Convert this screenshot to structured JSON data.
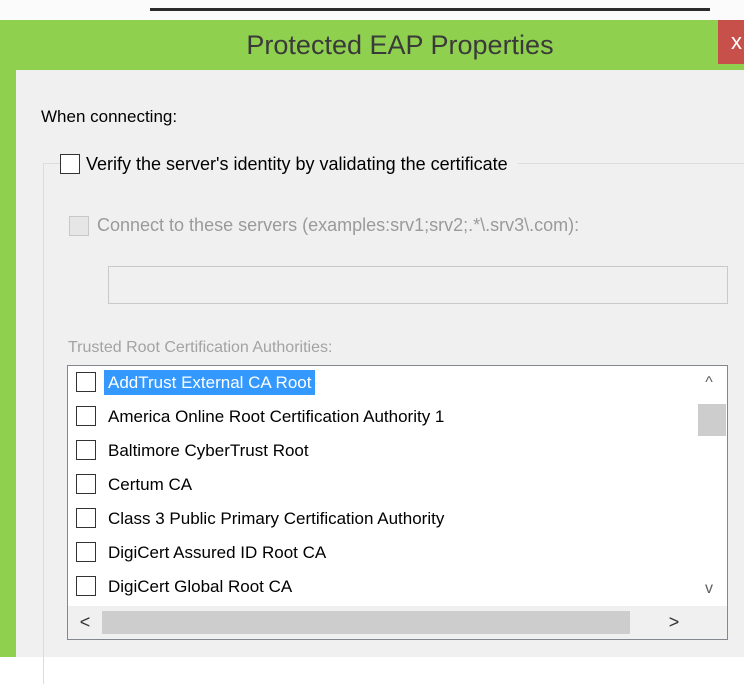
{
  "window": {
    "title": "Protected EAP Properties",
    "close_glyph": "x"
  },
  "section_label": "When connecting:",
  "verify": {
    "label": "Verify the server's identity by validating the certificate",
    "checked": false
  },
  "connect": {
    "label": "Connect to these servers (examples:srv1;srv2;.*\\.srv3\\.com):",
    "checked": false,
    "enabled": false,
    "value": ""
  },
  "trusted_root": {
    "label": "Trusted Root Certification Authorities:",
    "items": [
      {
        "label": "AddTrust External CA Root",
        "checked": false,
        "selected": true
      },
      {
        "label": "America Online Root Certification Authority 1",
        "checked": false,
        "selected": false
      },
      {
        "label": "Baltimore CyberTrust Root",
        "checked": false,
        "selected": false
      },
      {
        "label": "Certum CA",
        "checked": false,
        "selected": false
      },
      {
        "label": "Class 3 Public Primary Certification Authority",
        "checked": false,
        "selected": false
      },
      {
        "label": "DigiCert Assured ID Root CA",
        "checked": false,
        "selected": false
      },
      {
        "label": "DigiCert Global Root CA",
        "checked": false,
        "selected": false
      }
    ]
  },
  "scroll": {
    "up_glyph": "^",
    "down_glyph": "v",
    "left_glyph": "<",
    "right_glyph": ">"
  },
  "colors": {
    "title_bar": "#8fd14f",
    "close_button": "#c7504a",
    "selection": "#3399ff"
  }
}
